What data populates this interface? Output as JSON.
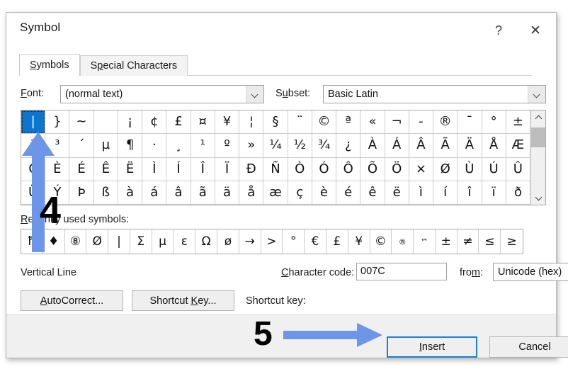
{
  "dialog": {
    "title": "Symbol",
    "titlebar_buttons": [
      {
        "name": "help-button",
        "glyph": "?"
      },
      {
        "name": "close-button",
        "glyph": "✕"
      }
    ],
    "tabs": [
      {
        "label": "Symbols",
        "accel": "S",
        "active": true
      },
      {
        "label": "Special Characters",
        "accel": "p",
        "active": false
      }
    ],
    "font": {
      "label": "Font:",
      "accel": "F",
      "value": "(normal text)"
    },
    "subset": {
      "label": "Subset:",
      "accel": "u",
      "value": "Basic Latin"
    },
    "grid": {
      "columns": 21,
      "rows": 4,
      "selected_index": 0,
      "cells": [
        "|",
        "}",
        "~",
        "",
        "¡",
        "¢",
        "£",
        "¤",
        "¥",
        "¦",
        "§",
        "¨",
        "©",
        "ª",
        "«",
        "¬",
        "-",
        "®",
        "¯",
        "°",
        "±",
        "²",
        "³",
        "´",
        "µ",
        "¶",
        "·",
        "¸",
        "¹",
        "º",
        "»",
        "¼",
        "½",
        "¾",
        "¿",
        "À",
        "Á",
        "Â",
        "Ã",
        "Ä",
        "Å",
        "Æ",
        "Ç",
        "È",
        "É",
        "Ê",
        "Ë",
        "Ì",
        "Í",
        "Î",
        "Ï",
        "Ð",
        "Ñ",
        "Ò",
        "Ó",
        "Ô",
        "Õ",
        "Ö",
        "×",
        "Ø",
        "Ù",
        "Ú",
        "Û",
        "Ü",
        "Ý",
        "Þ",
        "ß",
        "à",
        "á",
        "â",
        "ã",
        "ä",
        "å",
        "æ",
        "ç",
        "è",
        "é",
        "ê",
        "ë",
        "ì",
        "í",
        "î",
        "ï",
        "ð"
      ],
      "scrollbar": {
        "up": "▲",
        "down": "▼"
      }
    },
    "recent": {
      "label": "Recently used symbols:",
      "accel": "R",
      "cells": [
        "ħ",
        "♦",
        "⑧",
        "Ø",
        "|",
        "Σ",
        "μ",
        "ε",
        "Ω",
        "ø",
        "→",
        ">",
        "°",
        "€",
        "£",
        "¥",
        "©",
        "®",
        "™",
        "±"
      ],
      "cells_overflow": [
        "≠",
        "≤",
        "≥"
      ]
    },
    "symbol_name": "Vertical Line",
    "character_code": {
      "label": "Character code:",
      "accel": "C",
      "value": "007C"
    },
    "from": {
      "label": "from:",
      "accel": "m",
      "value": "Unicode (hex)"
    },
    "buttons": {
      "autocorrect": {
        "label": "AutoCorrect...",
        "accel": "A"
      },
      "shortcut_key": {
        "label": "Shortcut Key...",
        "accel": "K"
      },
      "insert": {
        "label": "Insert",
        "accel": "I"
      },
      "cancel": {
        "label": "Cancel"
      }
    },
    "shortcut_key_label": "Shortcut key:"
  },
  "annotations": [
    {
      "name": "step-4",
      "text": "4",
      "arrow": "up",
      "target": "selected-symbol-cell"
    },
    {
      "name": "step-5",
      "text": "5",
      "arrow": "right",
      "target": "insert-button"
    }
  ],
  "colors": {
    "selection_blue": "#0b76d0",
    "annotation_blue": "#6d95e8",
    "focus_border_blue": "#1a81d6",
    "dialog_bg": "#ffffff",
    "footer_bg": "#f0f0f0"
  }
}
